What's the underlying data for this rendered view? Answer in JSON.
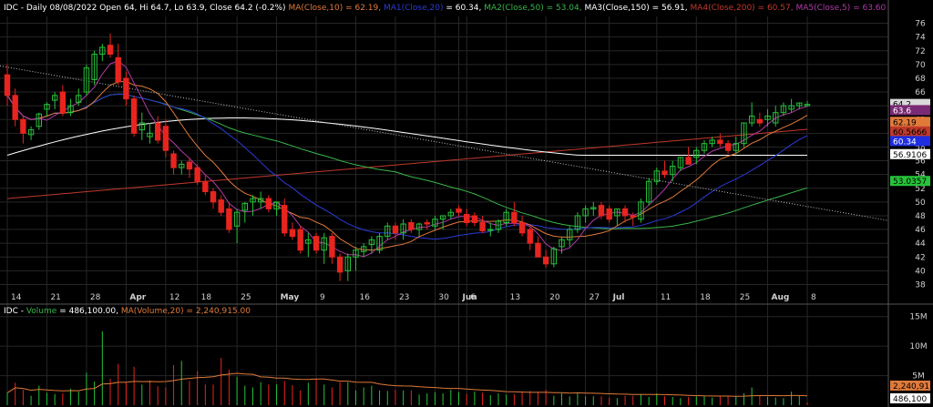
{
  "price_header": {
    "prefix": "IDC - Daily 08/08/2022 Open 64, Hi 64.7, Lo 63.9, Close 64.2 (-0.2%)",
    "items": [
      {
        "text": "MA(Close,10) = 62.19,",
        "color": "#e07a3a"
      },
      {
        "text": "MA1(Close,20)",
        "color": "#2b3bd6"
      },
      {
        "text": "= 60.34,",
        "color": "#ffffff"
      },
      {
        "text": "MA2(Close,50) = 53.04,",
        "color": "#39b54a"
      },
      {
        "text": "MA3(Close,150) = 56.91,",
        "color": "#ffffff"
      },
      {
        "text": "MA4(Close,200) = 60.57,",
        "color": "#c0392b"
      },
      {
        "text": "MA5(Close,5) = 63.60",
        "color": "#b03aa8"
      }
    ]
  },
  "volume_header": {
    "prefix": "IDC - ",
    "items": [
      {
        "text": "Volume",
        "color": "#39b54a"
      },
      {
        "text": "= 486,100.00,",
        "color": "#ffffff"
      },
      {
        "text": "MA(Volume,20) = 2,240,915.00",
        "color": "#e07a3a"
      }
    ]
  },
  "x_axis": {
    "labels": [
      "14",
      "21",
      "28",
      "Apr",
      "12",
      "18",
      "25",
      "May",
      "9",
      "16",
      "23",
      "30",
      "Jun",
      "6",
      "13",
      "20",
      "27",
      "Jul",
      "11",
      "18",
      "25",
      "Aug",
      "8"
    ],
    "bold": [
      "Apr",
      "May",
      "Jun",
      "Jul",
      "Aug"
    ]
  },
  "price_axis": {
    "ticks": [
      38,
      40,
      42,
      44,
      46,
      48,
      50,
      52,
      54,
      56,
      58,
      60,
      62,
      64,
      66,
      68,
      70,
      72,
      74,
      76
    ],
    "badges": [
      {
        "label": "64.2",
        "value": 64.2,
        "bg": "#d9d9d9",
        "fg": "#000000"
      },
      {
        "label": "63.6",
        "value": 63.3,
        "bg": "#7a2a74",
        "fg": "#ffffff"
      },
      {
        "label": "62.19",
        "value": 61.6,
        "bg": "#e07a3a",
        "fg": "#000000"
      },
      {
        "label": "60.5666",
        "value": 60.2,
        "bg": "#c0392b",
        "fg": "#000000"
      },
      {
        "label": "60.34",
        "value": 58.8,
        "bg": "#1f2ee0",
        "fg": "#ffffff"
      },
      {
        "label": "56.9106",
        "value": 56.9,
        "bg": "#ffffff",
        "fg": "#000000"
      },
      {
        "label": "53.0357",
        "value": 53.0,
        "bg": "#27c23a",
        "fg": "#000000"
      }
    ]
  },
  "volume_axis": {
    "ticks": [
      {
        "label": "15M",
        "value": 15000000
      },
      {
        "label": "10M",
        "value": 10000000
      },
      {
        "label": "5M",
        "value": 5000000
      }
    ],
    "badges": [
      {
        "label": "2,240,91",
        "value": 2240915,
        "bg": "#e07a3a",
        "fg": "#000000"
      },
      {
        "label": "486,100",
        "value": 486100,
        "bg": "#ffffff",
        "fg": "#000000"
      }
    ]
  },
  "colors": {
    "up": "#27c23a",
    "down": "#e8241f",
    "grid": "#262626",
    "text": "#d0d0d0"
  },
  "chart_data": {
    "type": "candlestick",
    "title": "IDC - Daily 08/08/2022",
    "ylim": [
      37,
      77
    ],
    "volume_ylim": [
      0,
      16500000
    ],
    "x": [
      "03-14",
      "03-15",
      "03-16",
      "03-17",
      "03-18",
      "03-21",
      "03-22",
      "03-23",
      "03-24",
      "03-25",
      "03-28",
      "03-29",
      "03-30",
      "03-31",
      "04-01",
      "04-04",
      "04-05",
      "04-06",
      "04-07",
      "04-08",
      "04-11",
      "04-12",
      "04-13",
      "04-14",
      "04-18",
      "04-19",
      "04-20",
      "04-21",
      "04-22",
      "04-25",
      "04-26",
      "04-27",
      "04-28",
      "04-29",
      "05-02",
      "05-03",
      "05-04",
      "05-05",
      "05-06",
      "05-09",
      "05-10",
      "05-11",
      "05-12",
      "05-13",
      "05-16",
      "05-17",
      "05-18",
      "05-19",
      "05-20",
      "05-23",
      "05-24",
      "05-25",
      "05-26",
      "05-27",
      "05-31",
      "06-01",
      "06-02",
      "06-03",
      "06-06",
      "06-07",
      "06-08",
      "06-09",
      "06-10",
      "06-13",
      "06-14",
      "06-15",
      "06-16",
      "06-17",
      "06-21",
      "06-22",
      "06-23",
      "06-24",
      "06-27",
      "06-28",
      "06-29",
      "06-30",
      "07-01",
      "07-05",
      "07-06",
      "07-07",
      "07-08",
      "07-11",
      "07-12",
      "07-13",
      "07-14",
      "07-15",
      "07-18",
      "07-19",
      "07-20",
      "07-21",
      "07-22",
      "07-25",
      "07-26",
      "07-27",
      "07-28",
      "07-29",
      "08-01",
      "08-02",
      "08-03",
      "08-04",
      "08-05",
      "08-08"
    ],
    "open": [
      68.5,
      65.5,
      62.0,
      59.8,
      61.0,
      63.5,
      64.8,
      66.0,
      63.0,
      64.5,
      66.0,
      67.8,
      71.5,
      72.8,
      71.0,
      68.0,
      65.0,
      60.5,
      59.5,
      61.5,
      61.0,
      57.0,
      55.0,
      55.8,
      55.0,
      53.0,
      51.5,
      50.3,
      49.0,
      46.5,
      48.8,
      50.0,
      50.0,
      50.5,
      49.0,
      49.5,
      46.0,
      46.0,
      44.0,
      45.0,
      43.0,
      45.0,
      42.0,
      40.0,
      42.0,
      42.8,
      43.8,
      43.0,
      45.0,
      46.5,
      45.5,
      47.0,
      46.0,
      47.0,
      46.5,
      47.5,
      48.0,
      49.0,
      48.2,
      48.0,
      47.0,
      46.0,
      46.0,
      47.0,
      48.5,
      47.0,
      46.0,
      44.0,
      42.0,
      41.0,
      43.5,
      44.5,
      46.0,
      48.0,
      49.0,
      49.5,
      49.0,
      48.0,
      49.0,
      48.0,
      47.5,
      50.0,
      53.0,
      54.5,
      54.0,
      55.0,
      56.5,
      56.5,
      57.5,
      58.5,
      59.0,
      58.5,
      57.5,
      58.5,
      61.5,
      62.0,
      62.0,
      61.5,
      63.0,
      63.5,
      64.0,
      64.0
    ],
    "high": [
      70.0,
      66.5,
      62.5,
      61.0,
      63.0,
      64.5,
      66.0,
      67.0,
      65.0,
      66.5,
      70.0,
      72.0,
      73.0,
      74.5,
      73.0,
      69.0,
      65.5,
      63.0,
      61.5,
      62.5,
      62.0,
      57.5,
      56.0,
      56.5,
      55.5,
      54.0,
      52.0,
      51.0,
      50.0,
      49.0,
      50.0,
      51.0,
      51.5,
      51.0,
      50.0,
      50.5,
      47.0,
      46.5,
      45.5,
      45.5,
      45.5,
      45.5,
      42.5,
      42.5,
      43.5,
      44.0,
      45.0,
      45.5,
      47.0,
      47.0,
      47.5,
      47.5,
      47.0,
      47.5,
      48.0,
      48.0,
      49.0,
      49.5,
      49.0,
      48.5,
      48.0,
      47.0,
      47.5,
      49.0,
      50.0,
      48.0,
      46.5,
      45.0,
      43.0,
      43.5,
      45.0,
      46.5,
      48.5,
      49.5,
      50.0,
      50.0,
      49.5,
      49.0,
      49.5,
      48.5,
      50.5,
      53.5,
      55.0,
      56.0,
      56.0,
      56.5,
      58.0,
      58.0,
      59.0,
      59.5,
      60.0,
      59.0,
      59.5,
      61.5,
      64.5,
      63.0,
      63.5,
      64.0,
      64.5,
      65.0,
      64.5,
      64.7
    ],
    "low": [
      64.0,
      61.0,
      58.5,
      59.0,
      60.5,
      62.5,
      63.5,
      62.5,
      62.5,
      64.0,
      65.5,
      67.0,
      70.5,
      71.0,
      67.0,
      64.0,
      59.5,
      59.0,
      58.5,
      58.5,
      56.5,
      54.0,
      54.0,
      53.5,
      52.5,
      51.0,
      49.0,
      48.0,
      45.5,
      44.0,
      47.0,
      48.0,
      49.0,
      48.5,
      48.0,
      45.0,
      44.5,
      42.5,
      42.0,
      42.5,
      41.0,
      41.0,
      38.5,
      38.5,
      40.0,
      42.0,
      42.5,
      42.5,
      44.5,
      44.5,
      44.5,
      45.5,
      45.0,
      46.0,
      46.0,
      46.0,
      47.5,
      48.0,
      46.5,
      46.5,
      45.5,
      45.0,
      45.5,
      46.5,
      46.5,
      45.0,
      43.0,
      42.0,
      40.5,
      40.5,
      42.5,
      43.5,
      45.5,
      47.0,
      48.0,
      47.5,
      47.0,
      46.5,
      47.0,
      46.5,
      47.0,
      49.5,
      52.5,
      53.5,
      53.0,
      54.5,
      56.0,
      55.5,
      57.0,
      58.0,
      58.0,
      57.0,
      57.0,
      58.0,
      61.0,
      61.0,
      61.0,
      61.0,
      62.5,
      63.0,
      63.5,
      63.9
    ],
    "close": [
      65.5,
      62.0,
      60.0,
      60.5,
      62.8,
      64.2,
      65.5,
      63.0,
      64.0,
      65.5,
      69.5,
      71.5,
      72.5,
      71.5,
      67.5,
      65.0,
      60.0,
      61.5,
      60.0,
      59.0,
      57.5,
      55.0,
      55.5,
      54.8,
      53.0,
      51.5,
      50.0,
      48.5,
      46.0,
      48.5,
      49.8,
      50.5,
      50.5,
      49.0,
      50.0,
      45.5,
      45.0,
      43.0,
      44.5,
      43.0,
      44.8,
      42.0,
      39.8,
      42.0,
      43.0,
      43.5,
      44.5,
      45.0,
      46.5,
      45.5,
      46.8,
      46.0,
      46.8,
      46.8,
      47.5,
      48.0,
      48.5,
      48.5,
      47.0,
      47.0,
      45.8,
      46.0,
      47.2,
      48.5,
      47.0,
      45.5,
      44.0,
      42.0,
      41.0,
      43.2,
      44.5,
      46.0,
      48.0,
      49.0,
      49.2,
      48.0,
      47.5,
      49.0,
      48.0,
      47.8,
      50.0,
      53.0,
      54.5,
      54.0,
      55.2,
      56.5,
      55.5,
      57.5,
      58.5,
      59.0,
      58.5,
      57.5,
      58.5,
      61.5,
      62.5,
      61.5,
      62.5,
      63.0,
      64.0,
      64.0,
      64.4,
      64.2
    ],
    "volume": [
      2.1,
      3.8,
      2.6,
      1.6,
      3.3,
      2.1,
      1.9,
      2.0,
      2.8,
      2.3,
      5.5,
      4.0,
      12.5,
      4.5,
      7.0,
      3.9,
      6.5,
      3.5,
      4.2,
      3.2,
      3.0,
      6.8,
      7.5,
      4.1,
      5.8,
      3.5,
      3.5,
      8.0,
      6.0,
      4.8,
      3.3,
      3.0,
      3.9,
      3.5,
      3.5,
      4.1,
      3.4,
      2.5,
      3.8,
      4.4,
      3.5,
      3.0,
      3.9,
      3.9,
      2.5,
      3.0,
      3.3,
      2.5,
      2.4,
      2.6,
      2.5,
      2.5,
      1.8,
      2.0,
      2.2,
      2.0,
      2.6,
      2.2,
      1.9,
      2.3,
      2.1,
      1.7,
      2.0,
      1.8,
      1.9,
      2.2,
      2.4,
      2.3,
      2.6,
      1.6,
      2.0,
      1.5,
      2.2,
      1.5,
      1.5,
      1.5,
      1.3,
      1.2,
      1.6,
      1.6,
      1.9,
      1.4,
      2.0,
      1.5,
      1.4,
      1.2,
      1.4,
      1.5,
      1.6,
      1.3,
      1.6,
      1.6,
      1.5,
      2.0,
      3.0,
      1.7,
      1.4,
      1.3,
      1.2,
      2.3,
      1.7,
      0.49
    ]
  }
}
